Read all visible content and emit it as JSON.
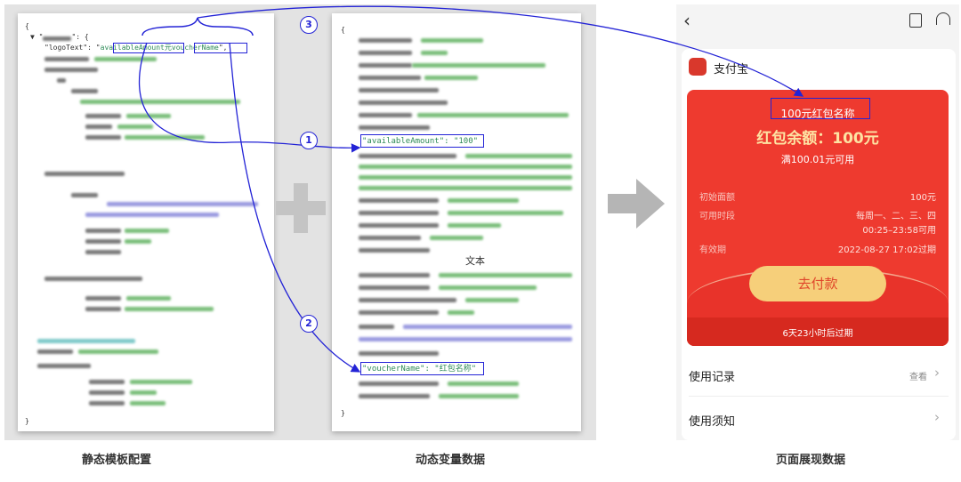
{
  "template_code": {
    "logo_key": "\"logoText\": \"",
    "logo_var1": "availableAmount",
    "logo_mid": "元",
    "logo_var2": "voucherName",
    "logo_end": "\","
  },
  "data_code": {
    "open_brace": "{",
    "close_brace": "}",
    "available_amount_line": "availableAmount\": \"100\"",
    "voucher_name_line": "voucherName\": \"红包名称\"",
    "blurred_text": "文本"
  },
  "markers": {
    "one": "1",
    "two": "2",
    "three": "3"
  },
  "captions": {
    "left": "静态模板配置",
    "middle": "动态变量数据",
    "right": "页面展现数据"
  },
  "phone": {
    "back_icon": "chevron-left-icon",
    "trash_icon": "trash-icon",
    "support_icon": "headset-icon",
    "brand": "支付宝",
    "voucher_title": "100元红包名称",
    "balance": "红包余额：100元",
    "condition": "满100.01元可用",
    "rows": [
      {
        "label": "初始面额",
        "value": "100元"
      },
      {
        "label": "可用时段",
        "value": "每周一、二、三、四",
        "value2": "00:25–23:58可用"
      },
      {
        "label": "有效期",
        "value": "2022-08-27 17:02过期"
      }
    ],
    "pay_button": "去付款",
    "expire_note": "6天23小时后过期",
    "usage_record": "使用记录",
    "usage_record_action": "查看",
    "usage_notes": "使用须知",
    "colors": {
      "red": "#ee3a2f",
      "button": "#f6cf7a",
      "annotation": "#2323d6"
    }
  }
}
